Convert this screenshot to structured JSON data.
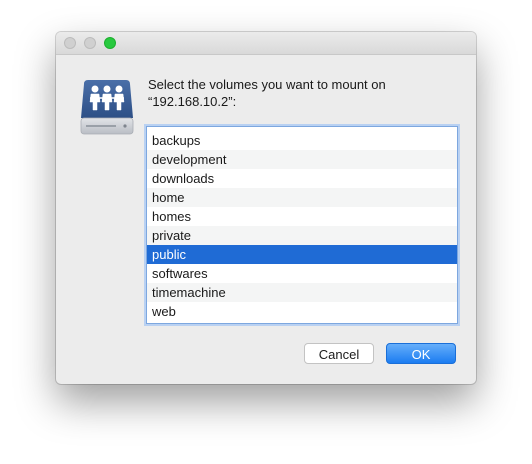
{
  "dialog": {
    "message_line1": "Select the volumes you want to mount on",
    "message_line2": "“192.168.10.2”:",
    "icon": "shared-server-volume-icon"
  },
  "volumes": [
    "backups",
    "development",
    "downloads",
    "home",
    "homes",
    "private",
    "public",
    "softwares",
    "timemachine",
    "web"
  ],
  "selected_volume": "public",
  "buttons": {
    "cancel_label": "Cancel",
    "ok_label": "OK"
  },
  "colors": {
    "selection": "#1f6bd5",
    "default_button": "#1b7cf1",
    "zoom_button": "#28c93f",
    "focus_ring": "#7da7df"
  }
}
